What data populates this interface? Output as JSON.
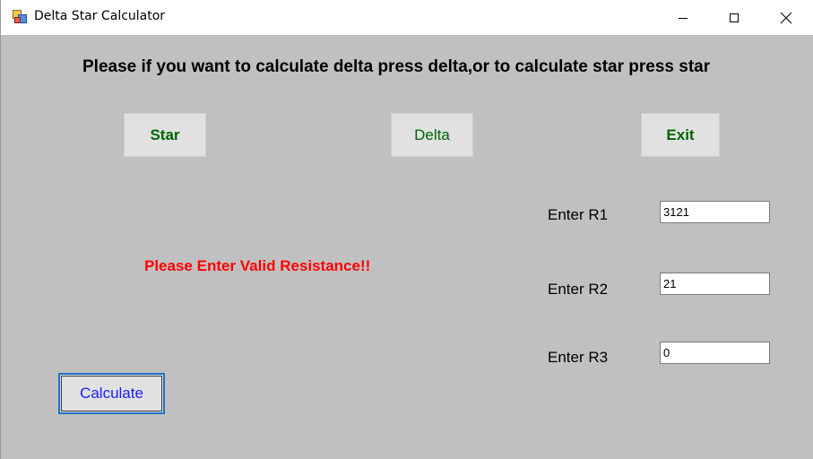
{
  "window": {
    "title": "Delta Star Calculator",
    "icon": "windows-forms-app-icon",
    "controls": {
      "minimize": "minimize-icon",
      "maximize": "maximize-icon",
      "close": "close-icon"
    }
  },
  "main": {
    "instructions": "Please if you want to calculate delta press delta,or to calculate star press star",
    "buttons": {
      "star": "Star",
      "delta": "Delta",
      "exit": "Exit",
      "calculate": "Calculate"
    },
    "error_message": "Please Enter Valid Resistance!!",
    "fields": [
      {
        "label": "Enter R1",
        "value": "3121"
      },
      {
        "label": "Enter R2",
        "value": "21"
      },
      {
        "label": "Enter R3",
        "value": "0"
      }
    ]
  },
  "colors": {
    "form_background": "#c0c0c0",
    "button_text_green": "#006400",
    "calculate_text_blue": "#1a1aff",
    "error_red": "#ff0000"
  }
}
